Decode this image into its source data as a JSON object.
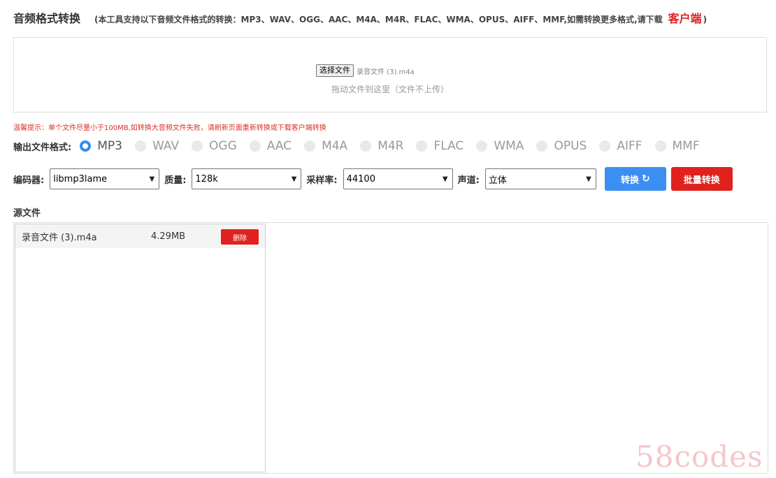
{
  "header": {
    "title": "音频格式转换",
    "support_text": "(本工具支持以下音频文件格式的转换：MP3、WAV、OGG、AAC、M4A、M4R、FLAC、WMA、OPUS、AIFF、MMF,如需转换更多格式,请下载",
    "client_link": "客户端",
    "close_paren": ")"
  },
  "upload": {
    "choose_button": "选择文件",
    "chosen_file": "录音文件 (3).m4a",
    "drop_hint": "拖动文件到这里（文件不上传）"
  },
  "tip": "温馨提示：单个文件尽量小于100MB,如转换大音频文件失败，请刷新页面重新转换或下载客户端转换",
  "formats": {
    "label": "输出文件格式:",
    "options": [
      "MP3",
      "WAV",
      "OGG",
      "AAC",
      "M4A",
      "M4R",
      "FLAC",
      "WMA",
      "OPUS",
      "AIFF",
      "MMF"
    ],
    "selected": "MP3"
  },
  "options": {
    "encoder_label": "编码器:",
    "encoder_value": "libmp3lame",
    "quality_label": "质量:",
    "quality_value": "128k",
    "samplerate_label": "采样率:",
    "samplerate_value": "44100",
    "channel_label": "声道:",
    "channel_value": "立体",
    "convert_button": "转换",
    "batch_button": "批量转换"
  },
  "source": {
    "label": "源文件",
    "files": [
      {
        "name": "录音文件 (3).m4a",
        "size": "4.29MB",
        "delete": "删除"
      }
    ]
  },
  "watermark": "58codes",
  "colors": {
    "accent_blue": "#3b8ff2",
    "accent_red": "#e0221e",
    "tip_red": "#d9332b"
  }
}
